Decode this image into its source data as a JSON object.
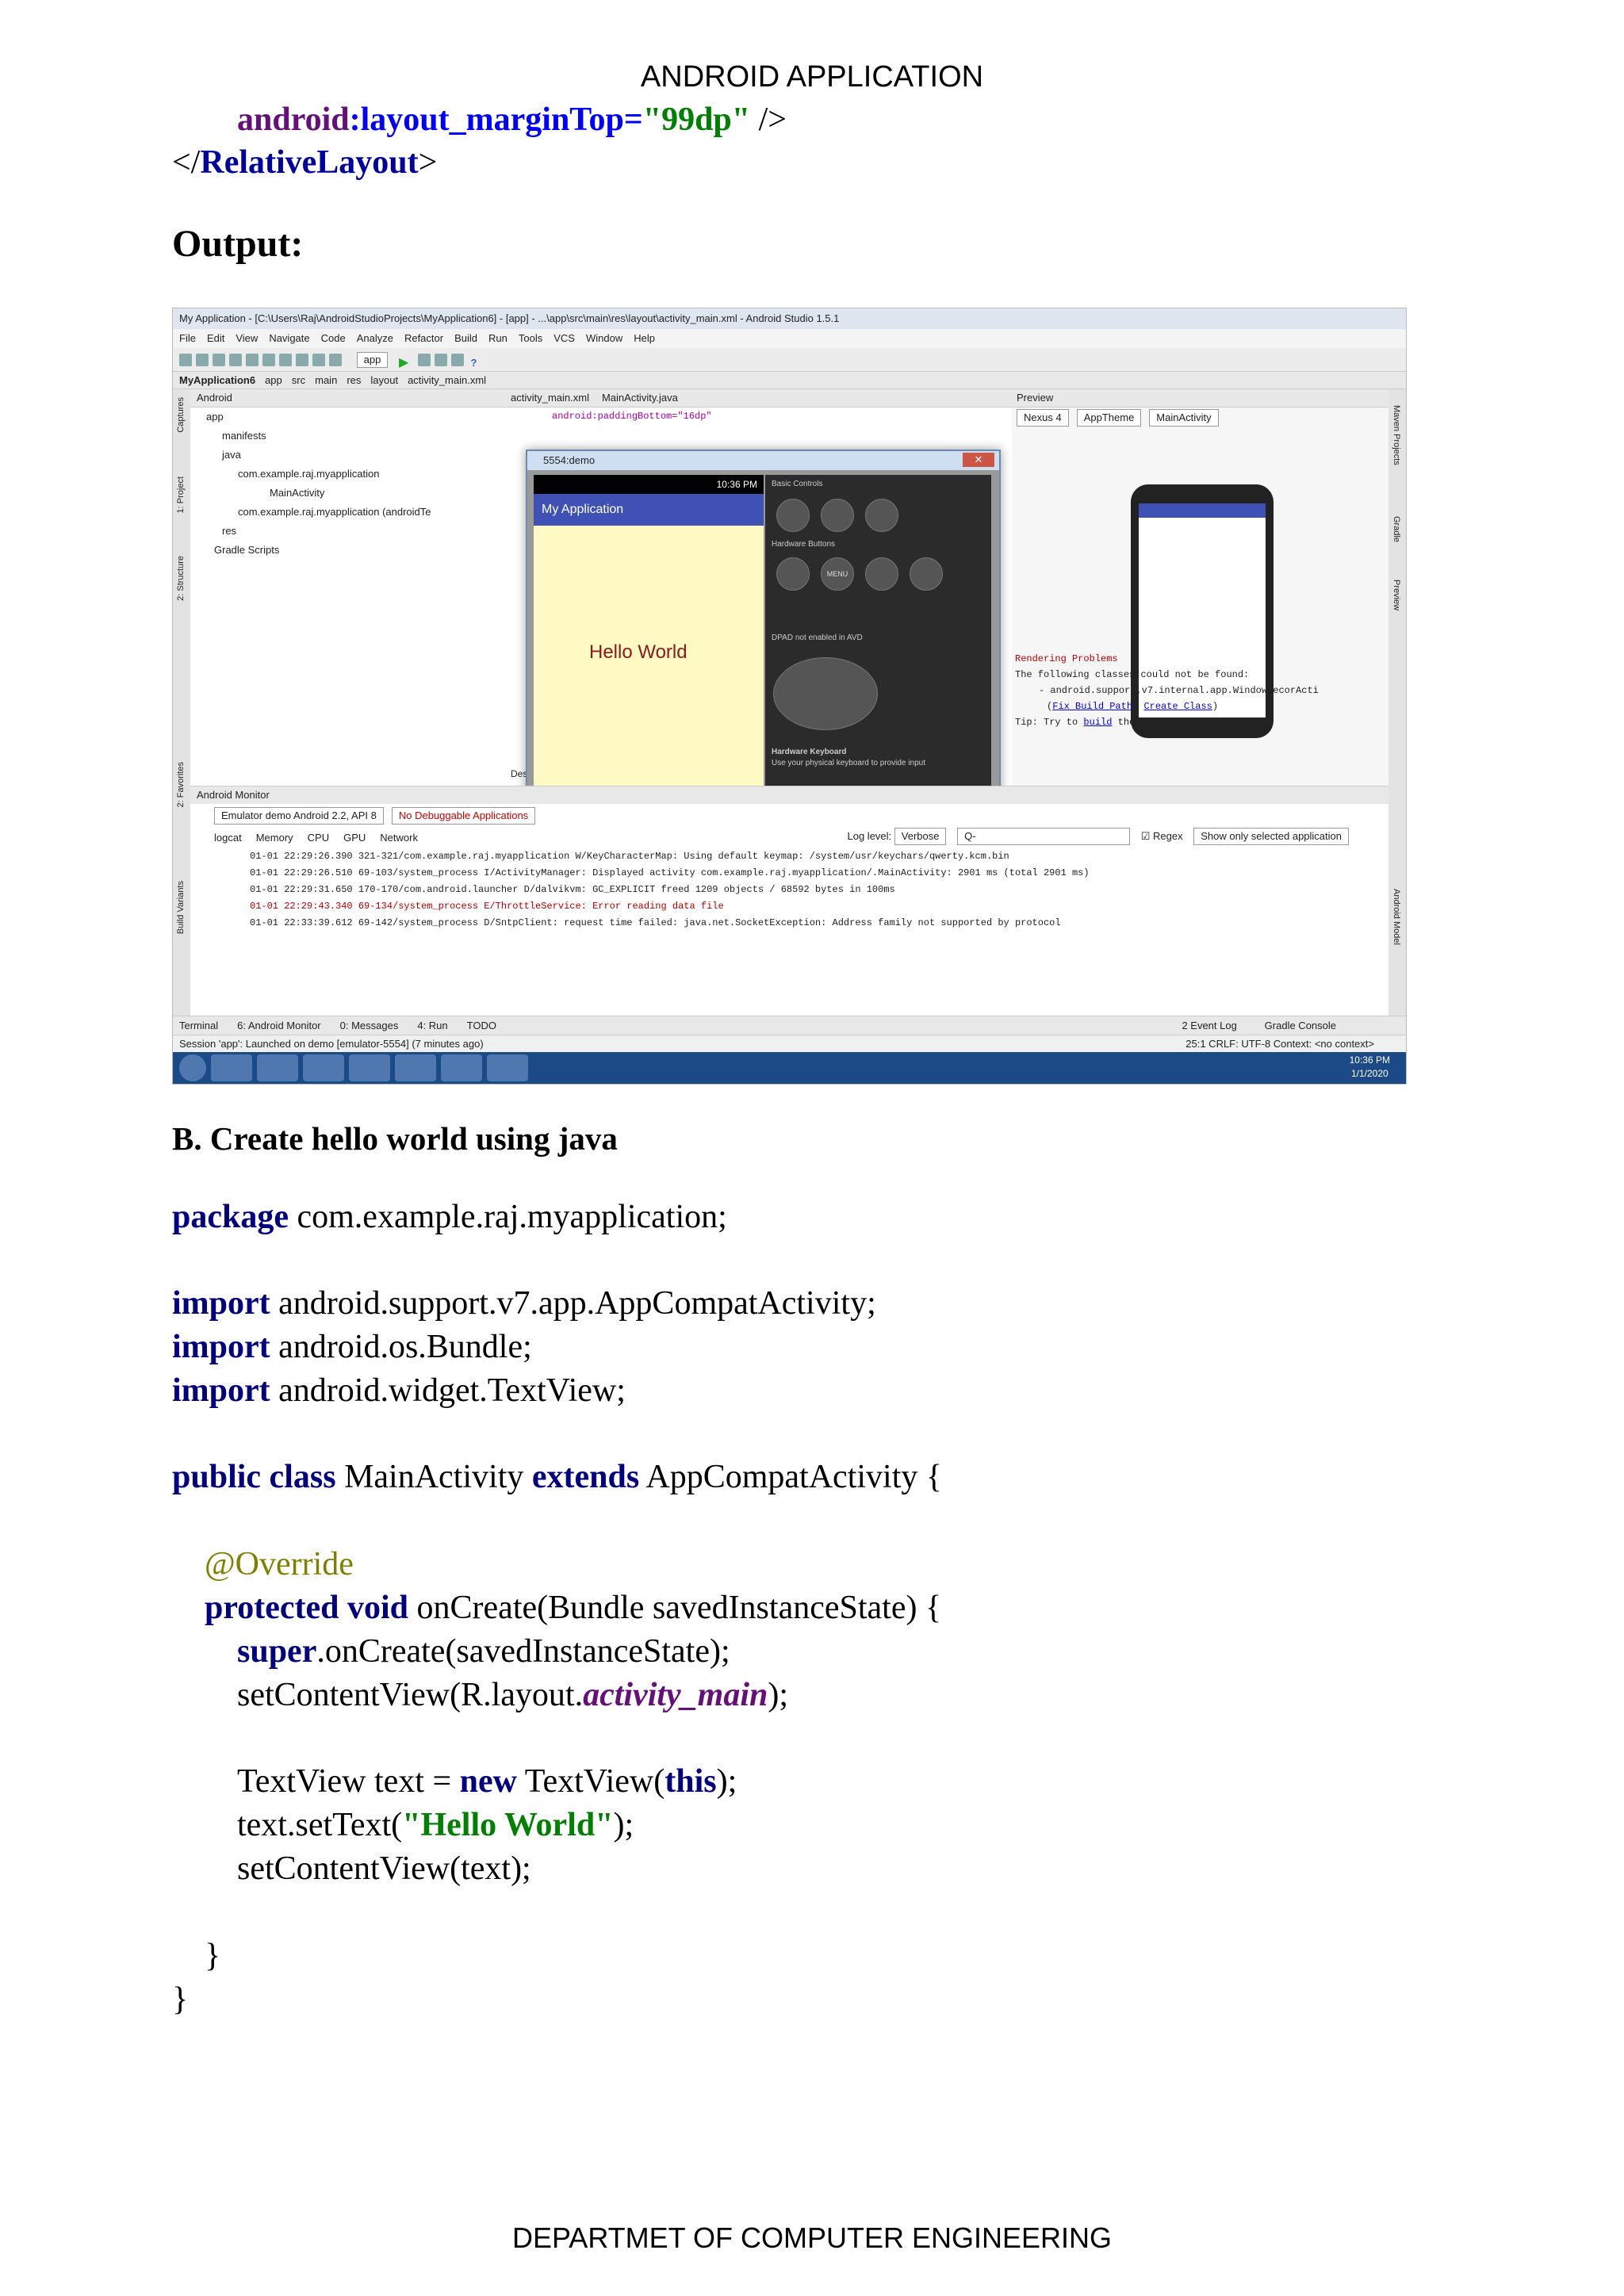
{
  "header": "ANDROID APPLICATION",
  "footer": "DEPARTMET OF COMPUTER ENGINEERING",
  "xml_tail": {
    "attr_ns": "android",
    "attr_name": ":layout_marginTop=",
    "attr_value": "\"99dp\"",
    "self_close": " />",
    "close_open": "</",
    "close_tag": "RelativeLayout",
    "close_end": ">"
  },
  "output_heading": "Output:",
  "section_heading": "B. Create hello world using java",
  "java": {
    "kw_package": "package",
    "package_name": " com.example.raj.myapplication;",
    "kw_import": "import",
    "imports": [
      " android.support.v7.app.AppCompatActivity;",
      " android.os.Bundle;",
      " android.widget.TextView;"
    ],
    "kw_public_class": "public class",
    "class_name": " MainActivity ",
    "kw_extends": "extends",
    "super_class": " AppCompatActivity {",
    "annotation": "@Override",
    "kw_protected_void": "protected void",
    "method_sig": " onCreate(Bundle savedInstanceState) {",
    "kw_super": "super",
    "super_call": ".onCreate(savedInstanceState);",
    "set_content_a": "setContentView(R.layout.",
    "set_content_field": "activity_main",
    "set_content_b": ");",
    "tv_a": "TextView text = ",
    "kw_new": "new",
    "tv_b": " TextView(",
    "kw_this": "this",
    "tv_c": ");",
    "settext_a": "text.setText(",
    "settext_str": "\"Hello World\"",
    "settext_b": ");",
    "setcontent2": "setContentView(text);",
    "close_method": "}",
    "close_class": "}"
  },
  "screenshot": {
    "title": "My Application - [C:\\Users\\Raj\\AndroidStudioProjects\\MyApplication6] - [app] - ...\\app\\src\\main\\res\\layout\\activity_main.xml - Android Studio 1.5.1",
    "menu": [
      "File",
      "Edit",
      "View",
      "Navigate",
      "Code",
      "Analyze",
      "Refactor",
      "Build",
      "Run",
      "Tools",
      "VCS",
      "Window",
      "Help"
    ],
    "run_config": "app",
    "breadcrumb": [
      "MyApplication6",
      "app",
      "src",
      "main",
      "res",
      "layout",
      "activity_main.xml"
    ],
    "project_view": "Android",
    "tree": [
      "app",
      "manifests",
      "java",
      "com.example.raj.myapplication",
      "MainActivity",
      "com.example.raj.myapplication (androidTe",
      "res",
      "Gradle Scripts"
    ],
    "left_strip": [
      "1: Project",
      "2: Structure",
      "Captures",
      "2: Favorites",
      "Build Variants"
    ],
    "right_strip": [
      "Maven Projects",
      "Gradle",
      "Preview",
      "Android Model"
    ],
    "editor_tabs": [
      "activity_main.xml",
      "MainActivity.java"
    ],
    "editor_line": "android:paddingBottom=\"16dp\"",
    "design_tab": "Des",
    "preview_title": "Preview",
    "preview_tools": [
      "Nexus 4",
      "AppTheme",
      "MainActivity"
    ],
    "render": {
      "title": "Rendering Problems",
      "line1": "The following classes could not be found:",
      "line2": "- android.support.v7.internal.app.WindowDecorActi",
      "fix": "Fix Build Path",
      "create": "Create Class",
      "tip_a": "Tip: Try to ",
      "tip_link": "build",
      "tip_b": " the project."
    },
    "emulator": {
      "title": "5554:demo",
      "time": "10:36 PM",
      "app_title": "My Application",
      "hello": "Hello World",
      "basic_controls": "Basic Controls",
      "hardware_buttons": "Hardware Buttons",
      "menu_btn": "MENU",
      "dpad": "DPAD not enabled in AVD",
      "keyboard": "Hardware Keyboard",
      "keyboard_sub": "Use your physical keyboard to provide input"
    },
    "monitor": {
      "title": "Android Monitor",
      "device": "Emulator demo Android 2.2, API 8",
      "process": "No Debuggable Applications",
      "tabs": [
        "logcat",
        "Memory",
        "CPU",
        "GPU",
        "Network"
      ],
      "log_level_label": "Log level:",
      "log_level": "Verbose",
      "search_placeholder": "Q-",
      "regex": "Regex",
      "filter": "Show only selected application",
      "logs": [
        "01-01 22:29:26.390 321-321/com.example.raj.myapplication W/KeyCharacterMap: Using default keymap: /system/usr/keychars/qwerty.kcm.bin",
        "01-01 22:29:26.510 69-103/system_process I/ActivityManager: Displayed activity com.example.raj.myapplication/.MainActivity: 2901 ms (total 2901 ms)",
        "01-01 22:29:31.650 170-170/com.android.launcher D/dalvikvm: GC_EXPLICIT freed 1209 objects / 68592 bytes in 100ms",
        "01-01 22:29:43.340 69-134/system_process E/ThrottleService: Error reading data file",
        "01-01 22:33:39.612 69-142/system_process D/SntpClient: request time failed: java.net.SocketException: Address family not supported by protocol"
      ]
    },
    "bottom_tabs": [
      "Terminal",
      "6: Android Monitor",
      "0: Messages",
      "4: Run",
      "TODO"
    ],
    "bottom_right_tabs": [
      "2 Event Log",
      "Gradle Console"
    ],
    "status": "Session 'app': Launched on demo [emulator-5554] (7 minutes ago)",
    "status_right": "25:1  CRLF:  UTF-8  Context: <no context>",
    "clock_time": "10:36 PM",
    "clock_date": "1/1/2020"
  }
}
